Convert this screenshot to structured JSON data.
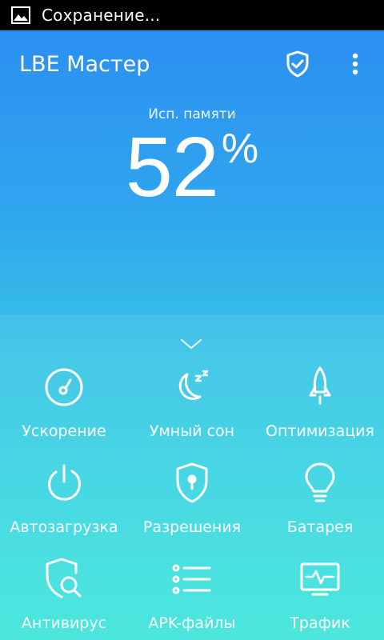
{
  "status_bar": {
    "text": "Сохранение..."
  },
  "header": {
    "title": "LBE Мастер"
  },
  "memory": {
    "label": "Исп. памяти",
    "value": "52",
    "unit": "%"
  },
  "tiles": [
    {
      "label": "Ускорение",
      "icon": "speedometer-icon"
    },
    {
      "label": "Умный сон",
      "icon": "sleep-moon-icon"
    },
    {
      "label": "Оптимизация",
      "icon": "rocket-icon"
    },
    {
      "label": "Автозагрузка",
      "icon": "power-icon"
    },
    {
      "label": "Разрешения",
      "icon": "shield-lock-icon"
    },
    {
      "label": "Батарея",
      "icon": "bulb-icon"
    },
    {
      "label": "Антивирус",
      "icon": "shield-search-icon"
    },
    {
      "label": "APK-файлы",
      "icon": "list-icon"
    },
    {
      "label": "Трафик",
      "icon": "monitor-pulse-icon"
    }
  ],
  "colors": {
    "gradient_top": "#2b8ff2",
    "gradient_bottom": "#3fe6da"
  }
}
